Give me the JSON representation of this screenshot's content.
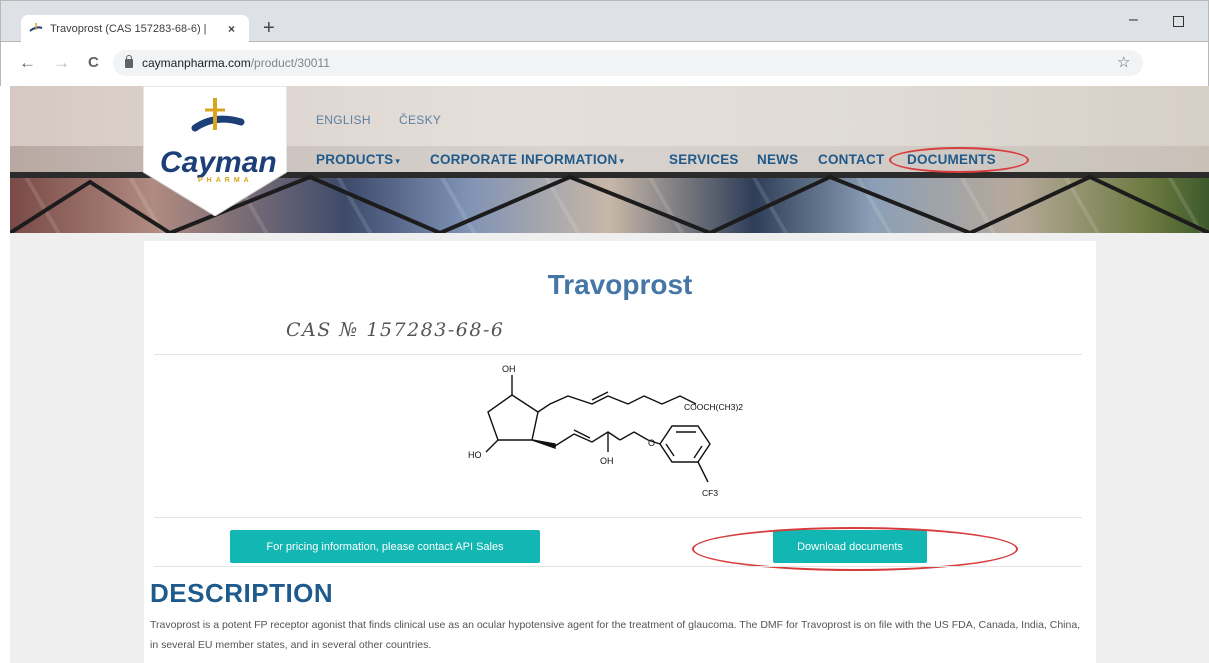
{
  "browser": {
    "tab_title": "Travoprost (CAS 157283-68-6) |",
    "tab_close": "×",
    "new_tab": "+",
    "url_host": "caymanpharma.com",
    "url_path": "/product/30011",
    "bookmark": "☆",
    "back": "←",
    "forward": "→",
    "reload": "C",
    "minimize": "–"
  },
  "header": {
    "logo_text": "Cayman",
    "logo_sub": "PHARMA",
    "languages": [
      "ENGLISH",
      "ČESKY"
    ],
    "menu": {
      "products": "PRODUCTS",
      "corporate": "CORPORATE INFORMATION",
      "services": "SERVICES",
      "news": "NEWS",
      "contact": "CONTACT",
      "documents": "DOCUMENTS",
      "caret": "▾"
    }
  },
  "product": {
    "title": "Travoprost",
    "cas": "CAS № 157283-68-6",
    "structure_labels": {
      "oh_top": "OH",
      "ester": "COOCH(CH3)2",
      "ho": "HO",
      "oh_bottom": "OH",
      "o": "O",
      "cf3": "CF3"
    },
    "pricing_button": "For pricing information, please contact API Sales",
    "download_button": "Download documents",
    "description_heading": "DESCRIPTION",
    "description_text": "Travoprost is a potent FP receptor agonist that finds clinical use as an ocular hypotensive agent for the treatment of glaucoma. The DMF for Travoprost is on file with the US FDA, Canada, India, China, in several EU member states, and in several other countries."
  },
  "colors": {
    "accent_button": "#12b6b2",
    "heading": "#1e5a8c",
    "title": "#4576a6",
    "annotation": "#d73c3c"
  }
}
